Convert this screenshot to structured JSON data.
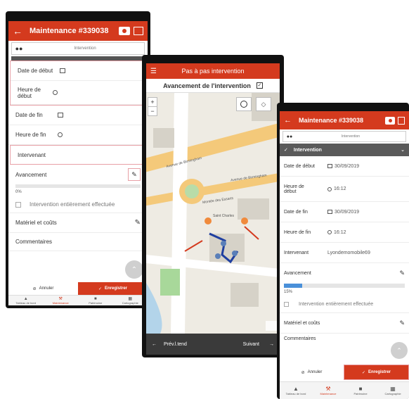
{
  "accent_color": "#d43a1e",
  "phone1": {
    "title": "Maintenance #339038",
    "sub_label": "Intervention",
    "rows": {
      "date_debut": "Date de début",
      "heure_debut": "Heure de début",
      "date_fin": "Date de fin",
      "heure_fin": "Heure de fin",
      "intervenant": "Intervenant",
      "avancement": "Avancement",
      "percent": "0%",
      "checkbox_label": "Intervention entièrement effectuée",
      "materiel": "Matériel et coûts",
      "commentaires": "Commentaires"
    },
    "progress": 0,
    "buttons": {
      "annuler": "Annuler",
      "enregistrer": "Enregistrer"
    },
    "tabs": [
      "Tableau de bord",
      "Maintenance",
      "Patrimoine",
      "Cartographie"
    ]
  },
  "phone2": {
    "title": "Pas à pas intervention",
    "subtitle": "Avancement de l'intervention",
    "map_labels": {
      "avenue1": "Avenue de Birmingham",
      "avenue2": "Avenue de Birmingham",
      "montee": "Montée des Essarts",
      "place": "Saint Charles"
    },
    "bottom": {
      "prev": "Prév.l.tend",
      "next": "Suivant"
    }
  },
  "phone3": {
    "title": "Maintenance #339038",
    "sub_label": "Intervention",
    "section": "Intervention",
    "rows": {
      "date_debut": "Date de début",
      "date_debut_val": "30/09/2019",
      "heure_debut": "Heure de début",
      "heure_debut_val": "16:12",
      "date_fin": "Date de fin",
      "date_fin_val": "30/09/2019",
      "heure_fin": "Heure de fin",
      "heure_fin_val": "16:12",
      "intervenant": "Intervenant",
      "intervenant_val": "Lyondemomobile69",
      "avancement": "Avancement",
      "percent": "15%",
      "checkbox_label": "Intervention entièrement effectuée",
      "materiel": "Matériel et coûts",
      "commentaires": "Commentaires"
    },
    "progress": 0.15,
    "buttons": {
      "annuler": "Annuler",
      "enregistrer": "Enregistrer"
    },
    "tabs": [
      "Tableau de bord",
      "Maintenance",
      "Patrimoine",
      "Cartographie"
    ]
  }
}
